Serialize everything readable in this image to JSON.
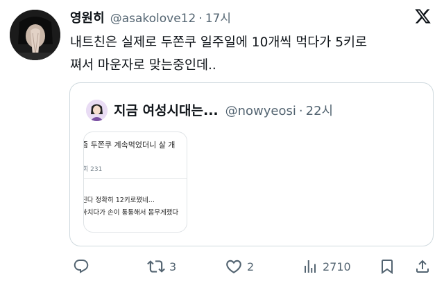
{
  "tweet": {
    "display_name": "영원히",
    "handle": "@asakolove12",
    "separator": "·",
    "time": "17시",
    "text_line1": "내트친은 실제로 두쫀쿠 일주일에 10개씩 먹다가 5키로",
    "text_line2": "쪄서 마운자로 맞는중인데.."
  },
  "quote": {
    "display_name": "지금 여성시대는...",
    "handle": "@nowyeosi",
    "separator": "·",
    "time": "22시",
    "card": {
      "title": "즘 두쫀쿠 계속먹었더니 살 개",
      "stat": "회 231",
      "body_line1": "진다 정확히 12키로쪘네...",
      "body_line2": "하치다가 손이 퉁퉁해서 몸무게쟀다"
    }
  },
  "actions": {
    "reply_count": "",
    "retweet_count": "3",
    "like_count": "2",
    "view_count": "2710"
  },
  "icons": [
    "x-logo-icon",
    "reply-icon",
    "retweet-icon",
    "like-icon",
    "views-icon",
    "bookmark-icon",
    "share-icon"
  ],
  "colors": {
    "text": "#0f1419",
    "secondary": "#536471",
    "border": "#cfd9de"
  }
}
